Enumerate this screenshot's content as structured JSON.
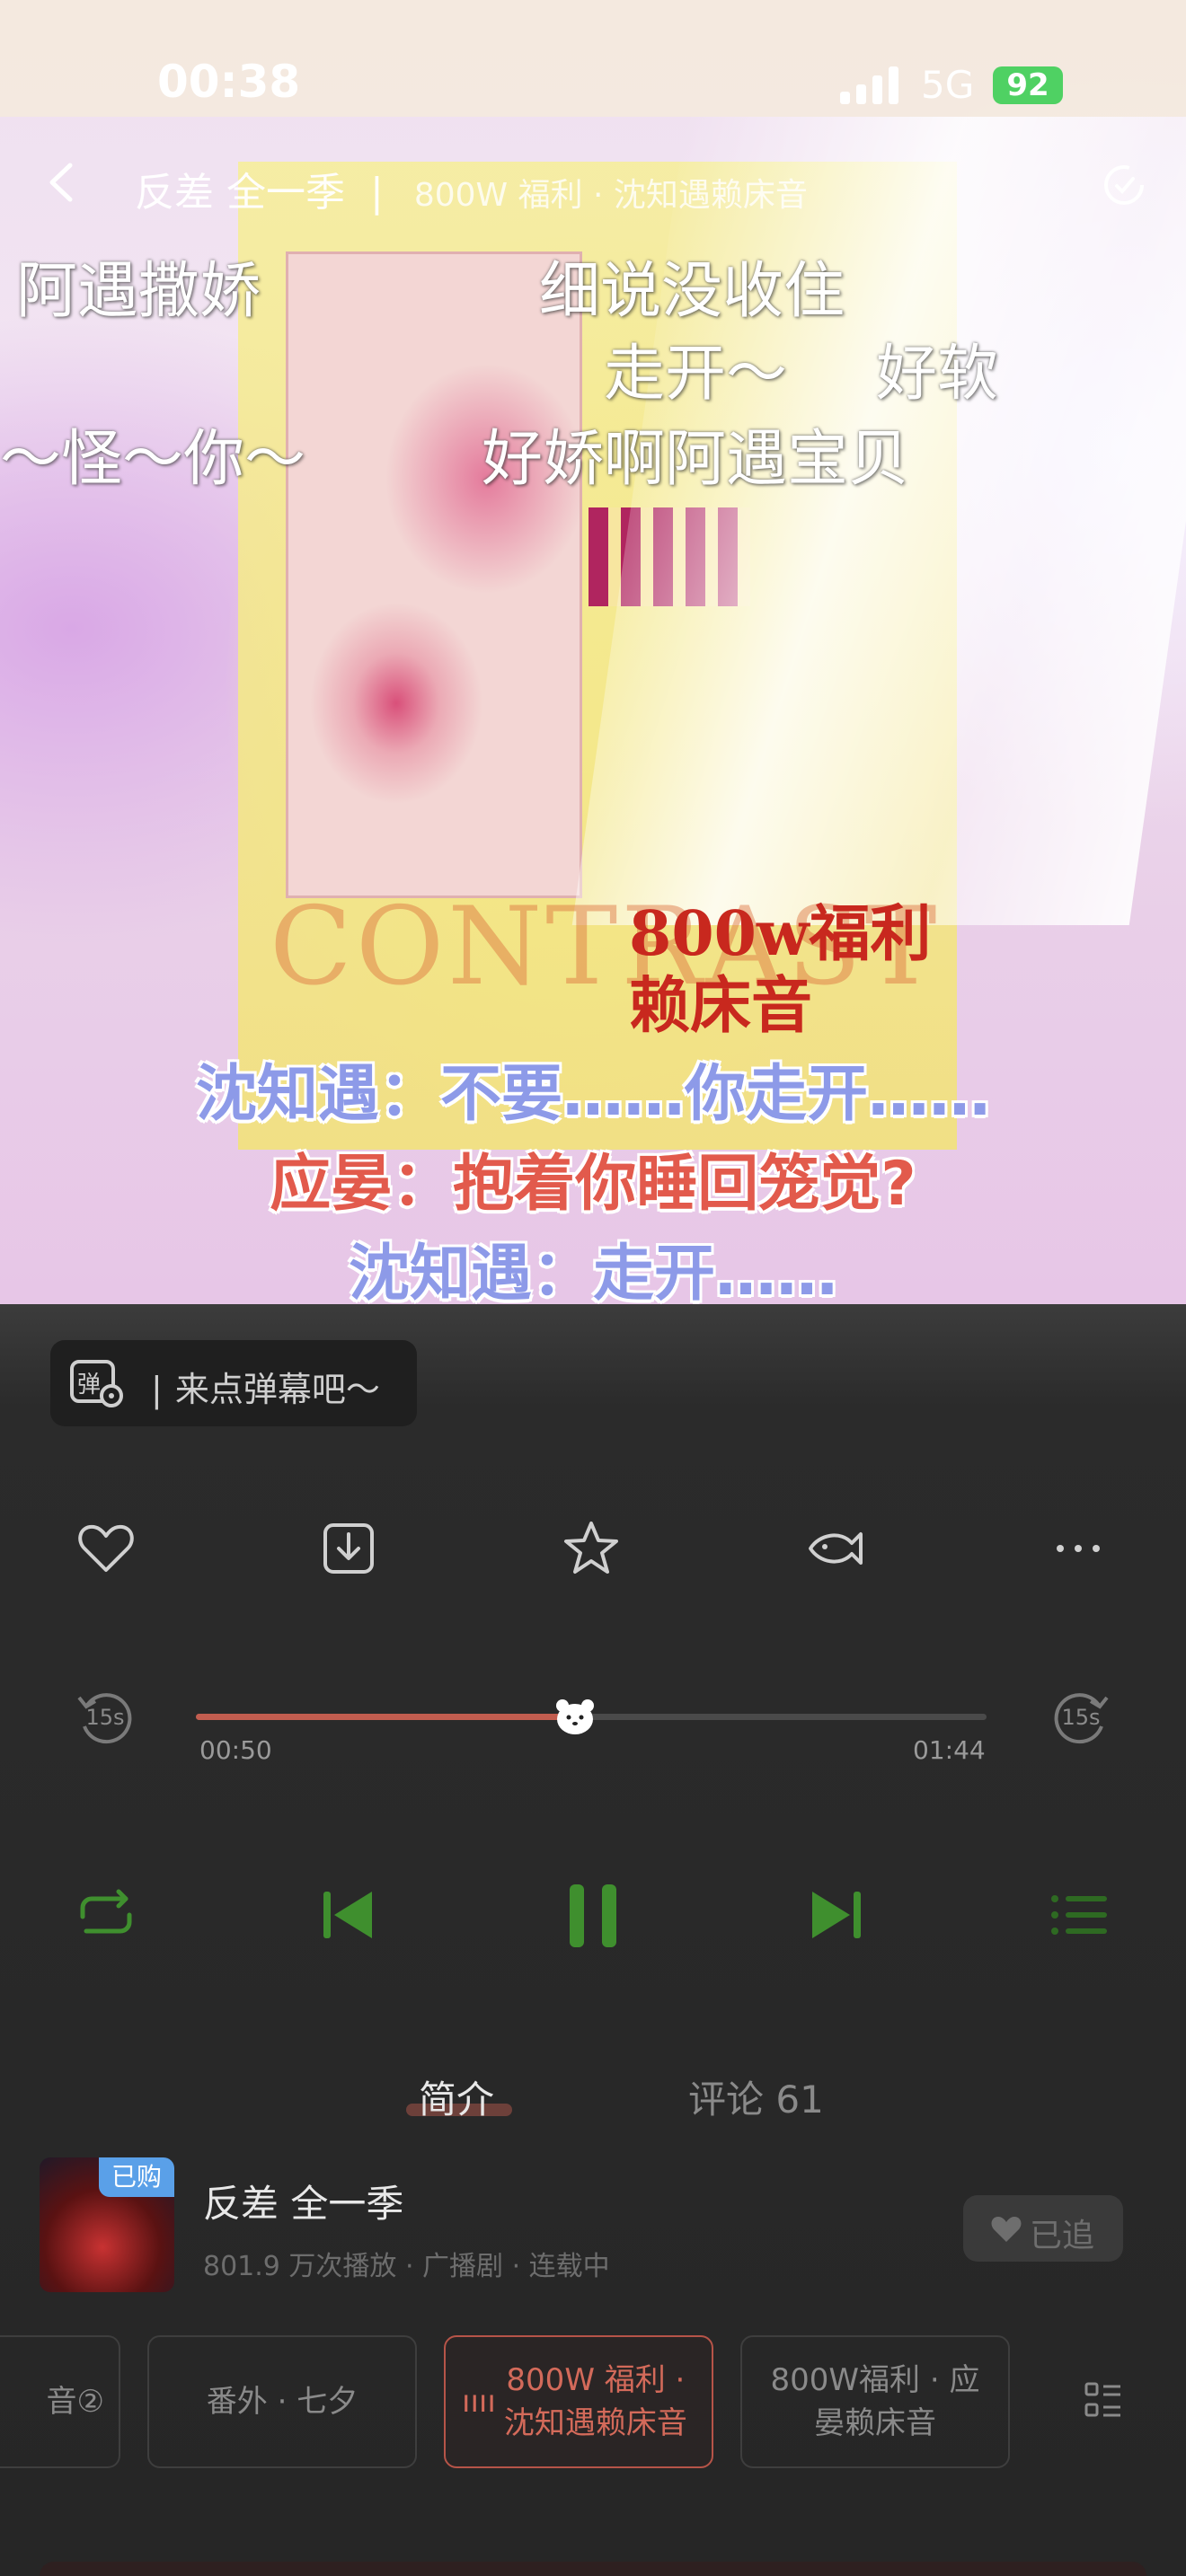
{
  "status_bar": {
    "time": "00:38",
    "network": "5G",
    "battery": "92"
  },
  "header": {
    "title": "反差 全一季",
    "separator": "|",
    "subtitle": "800W 福利 · 沈知遇赖床音"
  },
  "artwork": {
    "poster_red_text_1": "800w福利",
    "poster_red_text_2": "赖床音",
    "poster_word": "CONTRAST"
  },
  "danmaku": [
    "阿遇撒娇",
    "细说没收住",
    "走开～",
    "好软",
    "～怪～你～",
    "好娇啊阿遇宝贝"
  ],
  "subtitles": [
    "沈知遇：不要……你走开……",
    "应晏：抱着你睡回笼觉?",
    "沈知遇：走开……"
  ],
  "danmaku_input": {
    "placeholder": "来点弹幕吧～"
  },
  "actions": {
    "like": "like-icon",
    "download": "download-icon",
    "favorite": "star-icon",
    "gift": "fish-icon",
    "more": "more-icon"
  },
  "progress": {
    "current": "00:50",
    "total": "01:44",
    "fraction": 0.48,
    "rewind_label": "15s",
    "forward_label": "15s"
  },
  "tabs": {
    "intro": "简介",
    "comments": "评论 61"
  },
  "drama": {
    "badge": "已购",
    "title": "反差 全一季",
    "meta": "801.9 万次播放 · 广播剧 · 连载中",
    "follow_label": "已追"
  },
  "episodes": [
    {
      "label": "音②",
      "active": false
    },
    {
      "label": "番外 · 七夕",
      "active": false
    },
    {
      "label": "800W 福利 · 沈知遇赖床音",
      "active": true
    },
    {
      "label": "800W福利 · 应晏赖床音",
      "active": false
    }
  ],
  "colors": {
    "accent": "#c25d4f",
    "play_green": "#3f8f2e",
    "subtitle_blue": "#8d9ae8",
    "subtitle_red": "#e25a4c"
  }
}
